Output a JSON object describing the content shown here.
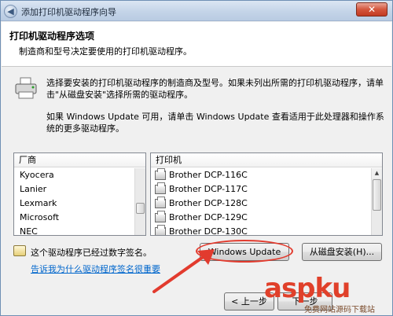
{
  "window": {
    "title": "添加打印机驱动程序向导",
    "close_glyph": "✕",
    "back_glyph": "◀"
  },
  "header": {
    "title": "打印机驱动程序选项",
    "subtitle": "制造商和型号决定要使用的打印机驱动程序。"
  },
  "description": {
    "line1": "选择要安装的打印机驱动程序的制造商及型号。如果未列出所需的打印机驱动程序，请单击\"从磁盘安装\"选择所需的驱动程序。",
    "line2": "如果 Windows Update 可用，请单击 Windows Update 查看适用于此处理器和操作系统的更多驱动程序。"
  },
  "manufacturer_list": {
    "header": "厂商",
    "items": [
      "Kyocera",
      "Lanier",
      "Lexmark",
      "Microsoft",
      "NEC"
    ]
  },
  "printer_list": {
    "header": "打印机",
    "items": [
      "Brother DCP-116C",
      "Brother DCP-117C",
      "Brother DCP-128C",
      "Brother DCP-129C",
      "Brother DCP-130C"
    ]
  },
  "signature": {
    "text": "这个驱动程序已经过数字签名。",
    "link": "告诉我为什么驱动程序签名很重要"
  },
  "buttons": {
    "windows_update": "Windows Update",
    "from_disk": "从磁盘安装(H)...",
    "back": "< 上一步",
    "next": "下一步"
  },
  "watermark": {
    "logo": "aspku",
    "tagline": "免费网站源码下载站"
  },
  "colors": {
    "accent_red": "#e23b2e",
    "link_blue": "#0066cc"
  }
}
